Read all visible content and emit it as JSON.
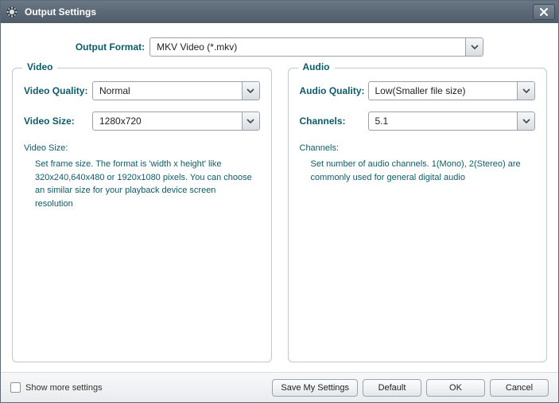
{
  "window": {
    "title": "Output Settings"
  },
  "format": {
    "label": "Output Format:",
    "value": "MKV Video (*.mkv)"
  },
  "video": {
    "legend": "Video",
    "quality": {
      "label": "Video Quality:",
      "value": "Normal"
    },
    "size": {
      "label": "Video Size:",
      "value": "1280x720"
    },
    "help": {
      "title": "Video Size:",
      "text": "Set frame size. The format is 'width x height' like 320x240,640x480 or 1920x1080 pixels. You can choose an similar size for your playback device screen resolution"
    }
  },
  "audio": {
    "legend": "Audio",
    "quality": {
      "label": "Audio Quality:",
      "value": "Low(Smaller file size)"
    },
    "channels": {
      "label": "Channels:",
      "value": "5.1"
    },
    "help": {
      "title": "Channels:",
      "text": "Set number of audio channels. 1(Mono), 2(Stereo) are commonly used for general digital audio"
    }
  },
  "footer": {
    "show_more": "Show more settings",
    "save": "Save My Settings",
    "default": "Default",
    "ok": "OK",
    "cancel": "Cancel"
  }
}
